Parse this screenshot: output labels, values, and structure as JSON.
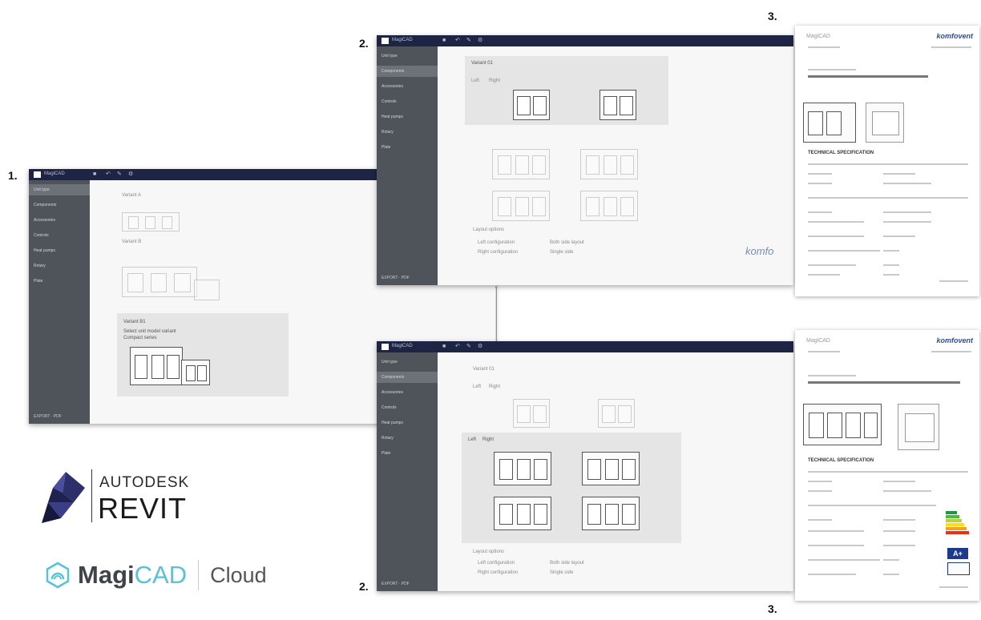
{
  "steps": {
    "step1": "1.",
    "step2_top": "2.",
    "step2_bottom": "2.",
    "step3_top": "3.",
    "step3_bottom": "3."
  },
  "app": {
    "title": "MagiCAD",
    "toolbar_icons": [
      "folder-icon",
      "undo-icon",
      "edit-icon",
      "settings-icon"
    ],
    "sidebar_items": [
      "Unit type",
      "Components",
      "Accessories",
      "Controls",
      "Heat pumps",
      "Rotary",
      "Plate"
    ],
    "footer": "EXPORT · PDF"
  },
  "screen1": {
    "labels": [
      "Variant A",
      "Variant B",
      "Variant B1"
    ],
    "panel_note": "Select unit model variant",
    "panel_sub": "Compact series"
  },
  "screen2": {
    "header": "Variant 01",
    "tabs": [
      "Left",
      "Right"
    ],
    "section": "Layout options",
    "options": [
      "Left configuration",
      "Right configuration",
      "Both side layout",
      "Single side"
    ]
  },
  "documents": {
    "brand": "komfovent",
    "logo": "MagiCAD",
    "section_title": "TECHNICAL SPECIFICATION",
    "energy_label": "A+"
  },
  "watermark": "komfo",
  "logos": {
    "autodesk": "AUTODESK",
    "revit": "REVIT",
    "magicad_bold": "Magi",
    "magicad_color": "CAD",
    "cloud": "Cloud"
  },
  "colors": {
    "topbar": "#1e2544",
    "sidebar": "#4e545a",
    "brand_blue": "#2b4e9c",
    "magicad_cyan": "#55c3d8"
  }
}
